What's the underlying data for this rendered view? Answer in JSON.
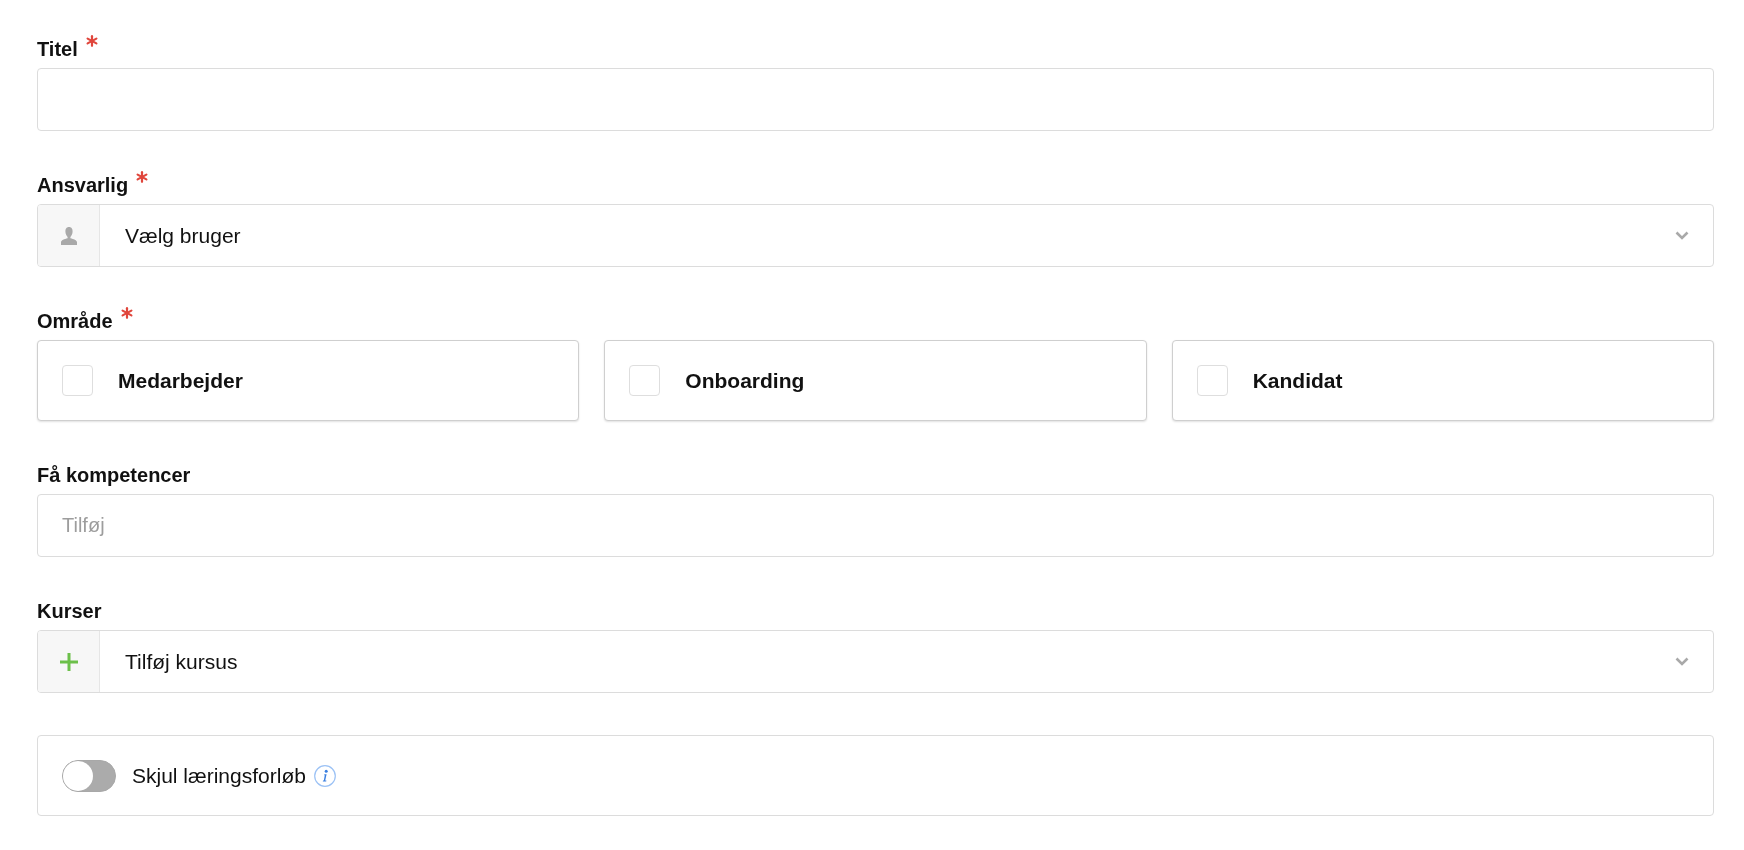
{
  "fields": [
    {
      "kind": "text",
      "label": "Titel",
      "required": true
    },
    {
      "kind": "userpicker",
      "label": "Ansvarlig",
      "required": true,
      "prompt": "Vælg bruger"
    },
    {
      "kind": "checkboxes",
      "label": "Område",
      "required": true,
      "options": [
        {
          "label": "Medarbejder",
          "checked": false
        },
        {
          "label": "Onboarding",
          "checked": false
        },
        {
          "label": "Kandidat",
          "checked": false
        }
      ]
    },
    {
      "kind": "tags",
      "label": "Få kompetencer",
      "required": false,
      "placeholder": "Tilføj"
    },
    {
      "kind": "coursepicker",
      "label": "Kurser",
      "required": false,
      "prompt": "Tilføj kursus"
    },
    {
      "kind": "toggle",
      "label": "Skjul læringsforløb",
      "on": false,
      "info": true
    }
  ]
}
